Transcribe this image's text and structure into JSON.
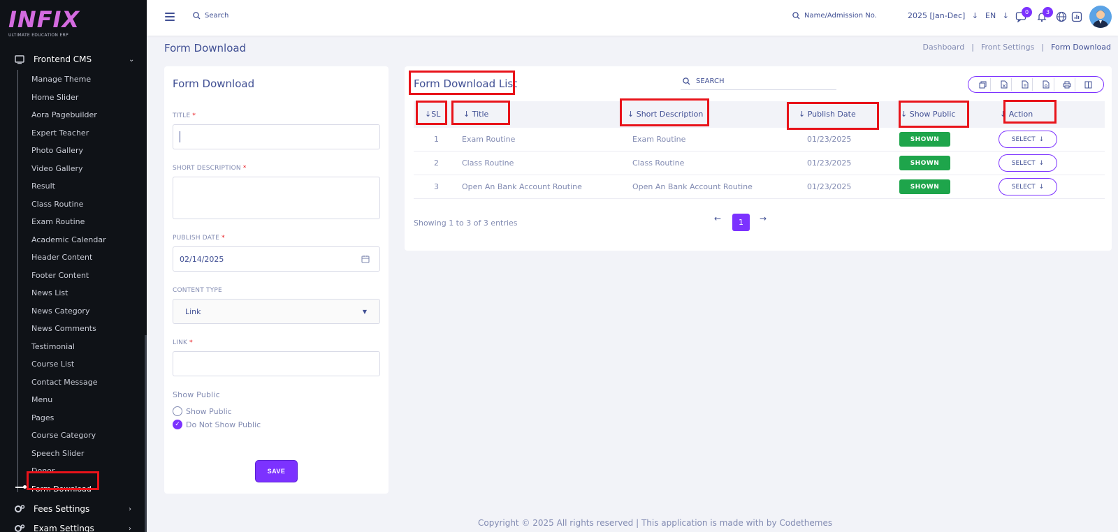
{
  "brand": {
    "logo_text": "INFIX",
    "tagline": "ULTIMATE EDUCATION ERP"
  },
  "sidebar": {
    "section": "Frontend CMS",
    "items": [
      "Manage Theme",
      "Home Slider",
      "Aora Pagebuilder",
      "Expert Teacher",
      "Photo Gallery",
      "Video Gallery",
      "Result",
      "Class Routine",
      "Exam Routine",
      "Academic Calendar",
      "Header Content",
      "Footer Content",
      "News List",
      "News Category",
      "News Comments",
      "Testimonial",
      "Course List",
      "Contact Message",
      "Menu",
      "Pages",
      "Course Category",
      "Speech Slider",
      "Donor",
      "Form Download"
    ],
    "next_sections": [
      "Fees Settings",
      "Exam Settings"
    ]
  },
  "topbar": {
    "search_label": "Search",
    "student_search_label": "Name/Admission No.",
    "academic_year": "2025 [Jan-Dec]",
    "language": "EN",
    "messages_count": "0",
    "notifications_count": "3"
  },
  "page": {
    "title": "Form Download",
    "breadcrumb": [
      "Dashboard",
      "Front Settings",
      "Form Download"
    ]
  },
  "form": {
    "title": "Form Download",
    "title_label": "TITLE",
    "title_value": "",
    "short_desc_label": "SHORT DESCRIPTION",
    "publish_date_label": "PUBLISH DATE",
    "publish_date_value": "02/14/2025",
    "content_type_label": "CONTENT TYPE",
    "content_type_value": "Link",
    "link_label": "LINK",
    "show_public_heading": "Show Public",
    "radio_show": "Show Public",
    "radio_hide": "Do Not Show Public",
    "save_label": "SAVE",
    "required_mark": "*"
  },
  "list": {
    "title": "Form Download List",
    "search_placeholder": "SEARCH",
    "columns": [
      "SL",
      "Title",
      "Short Description",
      "Publish Date",
      "Show Public",
      "Action"
    ],
    "rows": [
      {
        "sl": "1",
        "title": "Exam Routine",
        "desc": "Exam Routine",
        "date": "01/23/2025",
        "status": "SHOWN",
        "action": "SELECT"
      },
      {
        "sl": "2",
        "title": "Class Routine",
        "desc": "Class Routine",
        "date": "01/23/2025",
        "status": "SHOWN",
        "action": "SELECT"
      },
      {
        "sl": "3",
        "title": "Open An Bank Account Routine",
        "desc": "Open An Bank Account Routine",
        "date": "01/23/2025",
        "status": "SHOWN",
        "action": "SELECT"
      }
    ],
    "entries_text": "Showing 1 to 3 of 3 entries",
    "current_page": "1"
  },
  "footer": {
    "text": "Copyright © 2025 All rights reserved | This application is made with by Codethemes"
  },
  "colors": {
    "accent": "#7c32ff",
    "shown": "#1ea54b",
    "highlight": "#e8131a",
    "sidebar_bg": "#0f1217"
  }
}
